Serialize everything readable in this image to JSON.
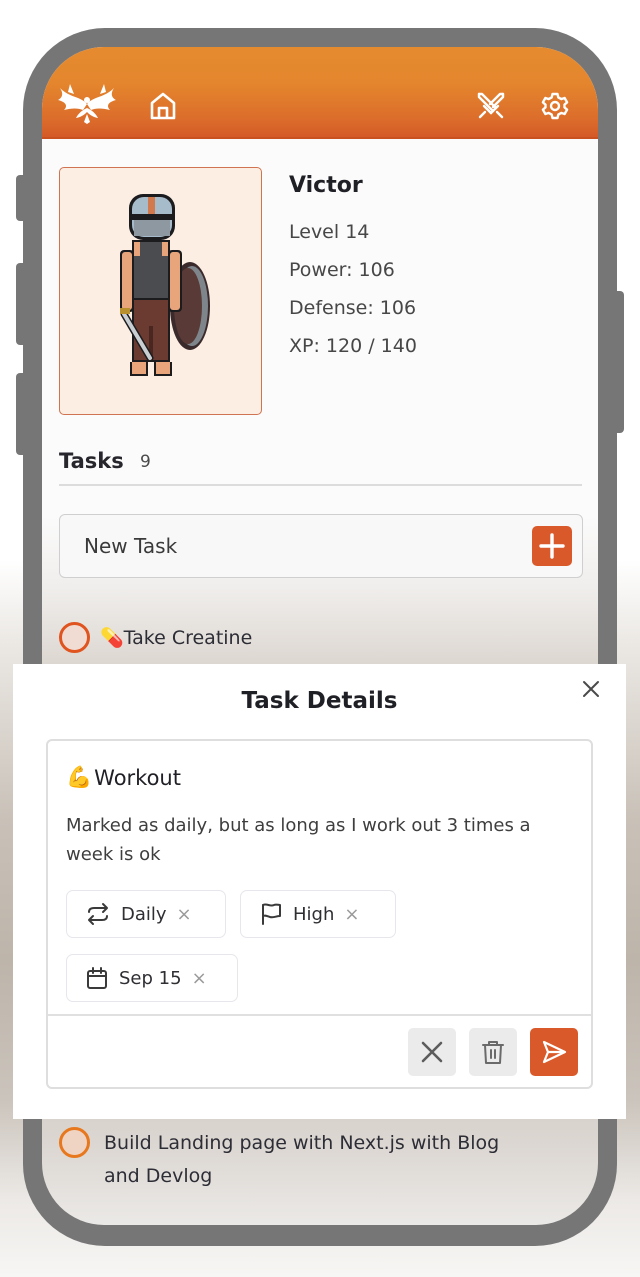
{
  "header": {
    "logo_icon": "phoenix-logo-icon",
    "nav": [
      {
        "name": "home",
        "icon": "home-icon"
      },
      {
        "name": "battle",
        "icon": "crossed-swords-icon"
      },
      {
        "name": "settings",
        "icon": "gear-icon"
      }
    ]
  },
  "character": {
    "name": "Victor",
    "level": "Level 14",
    "power": "Power: 106",
    "defense": "Defense: 106",
    "xp": "XP: 120 / 140",
    "xp_current": 120,
    "xp_max": 140,
    "avatar_icon": "pixel-knight-avatar"
  },
  "tasks": {
    "title": "Tasks",
    "count": "9",
    "new_task_label": "New Task",
    "add_icon": "plus-icon",
    "items": [
      {
        "emoji": "💊",
        "text": "Take Creatine"
      },
      {
        "emoji": "",
        "text": "Build Landing page with Next.js with Blog and Devlog"
      }
    ]
  },
  "modal": {
    "title": "Task Details",
    "close_icon": "close-icon",
    "task": {
      "emoji": "💪",
      "title": "Workout",
      "description": "Marked as daily, but as long as I work out 3 times a week is ok"
    },
    "chips": [
      {
        "icon": "repeat-icon",
        "label": "Daily",
        "remove": "×"
      },
      {
        "icon": "flag-icon",
        "label": "High",
        "remove": "×"
      },
      {
        "icon": "calendar-icon",
        "label": "Sep 15",
        "remove": "×"
      }
    ],
    "actions": [
      {
        "name": "cancel",
        "icon": "close-icon"
      },
      {
        "name": "delete",
        "icon": "trash-icon"
      },
      {
        "name": "send",
        "icon": "send-icon"
      }
    ]
  },
  "colors": {
    "accent": "#d9592a",
    "header_orange": "#e4862d",
    "frame_gray": "#777676"
  }
}
